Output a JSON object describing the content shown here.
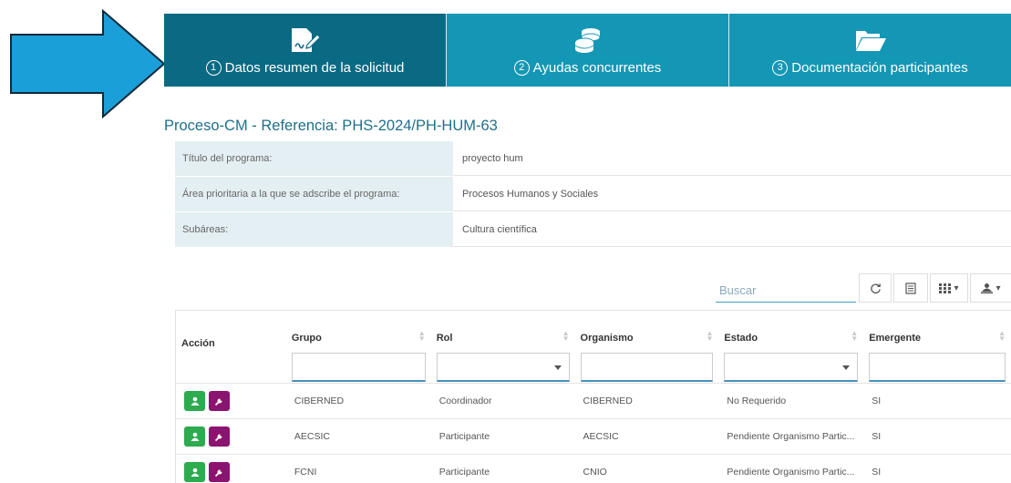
{
  "colors": {
    "step_active": "#0a6a83",
    "step": "#1497b4",
    "arrow": "#1a9fd8",
    "title": "#1f6f8b",
    "key_bg": "#e4eff3",
    "btn_green": "#2eaa4f",
    "btn_purple": "#8b1470"
  },
  "steps": [
    {
      "num": "1",
      "label": "Datos resumen de la solicitud",
      "icon": "document-sign-icon",
      "active": true
    },
    {
      "num": "2",
      "label": "Ayudas concurrentes",
      "icon": "coins-icon",
      "active": false
    },
    {
      "num": "3",
      "label": "Documentación participantes",
      "icon": "folder-open-icon",
      "active": false
    }
  ],
  "title": "Proceso-CM - Referencia: PHS-2024/PH-HUM-63",
  "summary": [
    {
      "key": "Título del programa:",
      "value": "proyecto hum"
    },
    {
      "key": "Área prioritaria a la que se adscribe el programa:",
      "value": "Procesos Humanos y Sociales"
    },
    {
      "key": "Subáreas:",
      "value": "Cultura científica"
    }
  ],
  "search": {
    "placeholder": "Buscar",
    "value": ""
  },
  "toolbar": [
    "refresh-icon",
    "export-icon",
    "columns-icon",
    "user-export-icon"
  ],
  "table": {
    "headers": [
      "Acción",
      "Grupo",
      "Rol",
      "Organismo",
      "Estado",
      "Emergente"
    ],
    "rows": [
      {
        "grupo": "CIBERNED",
        "rol": "Coordinador",
        "organismo": "CIBERNED",
        "estado": "No Requerido",
        "emergente": "SI"
      },
      {
        "grupo": "AECSIC",
        "rol": "Participante",
        "organismo": "AECSIC",
        "estado": "Pendiente Organismo Partic...",
        "emergente": "SI"
      },
      {
        "grupo": "FCNI",
        "rol": "Participante",
        "organismo": "CNIO",
        "estado": "Pendiente Organismo Partic...",
        "emergente": "SI"
      }
    ]
  }
}
